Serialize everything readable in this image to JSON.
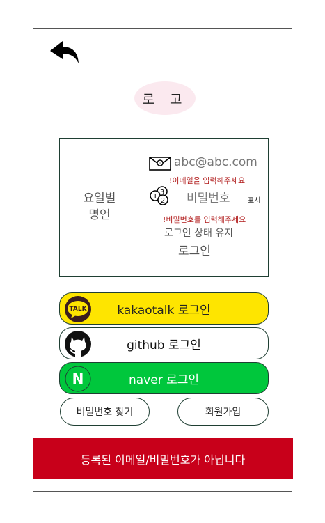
{
  "header": {
    "title": "로 고"
  },
  "quote": {
    "line1": "요일별",
    "line2": "명언"
  },
  "form": {
    "email_value": "abc@abc.com",
    "email_error": "!이메일을 입력해주세요",
    "password_placeholder": "비밀번호",
    "show_password": "표시",
    "password_error": "!비밀번호를 입력해주세요",
    "keep_login": "로그인 상태 유지",
    "login_button": "로그인"
  },
  "social": {
    "kakao_label": "kakaotalk 로그인",
    "kakao_badge": "TALK",
    "github_label": "github 로그인",
    "naver_label": "naver 로그인",
    "naver_badge": "N"
  },
  "links": {
    "find_password": "비밀번호 찾기",
    "signup": "회원가입"
  },
  "toast": {
    "message": "등록된 이메일/비밀번호가 아닙니다"
  },
  "colors": {
    "kakao": "#fee500",
    "naver": "#00c73c",
    "error": "#c8001a",
    "logo_bg": "#fbe9ef"
  },
  "icons": [
    "back-arrow-icon",
    "mail-icon",
    "password-icon",
    "kakaotalk-icon",
    "github-icon",
    "naver-icon"
  ]
}
